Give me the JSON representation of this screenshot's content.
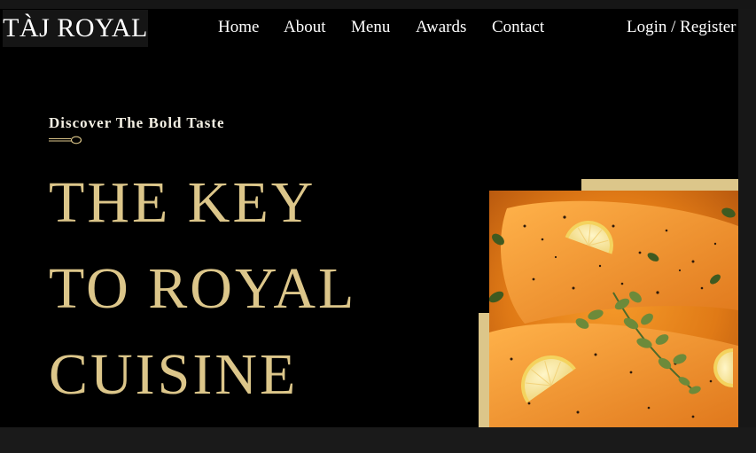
{
  "header": {
    "logo_text": "TÀJ ROYAL",
    "nav": [
      "Home",
      "About",
      "Menu",
      "Awards",
      "Contact"
    ],
    "auth_label": "Login / Register"
  },
  "hero": {
    "eyebrow": "Discover The Bold Taste",
    "headline": [
      "THE KEY",
      "TO ROYAL",
      "CUISINE"
    ],
    "image_icon": "salmon-dish-photo",
    "divider_icon": "spoon-icon"
  },
  "colors": {
    "background": "#000000",
    "accent_gold": "#dcc68a",
    "text_white": "#ffffff",
    "outer_frame": "#1c1c1c"
  }
}
